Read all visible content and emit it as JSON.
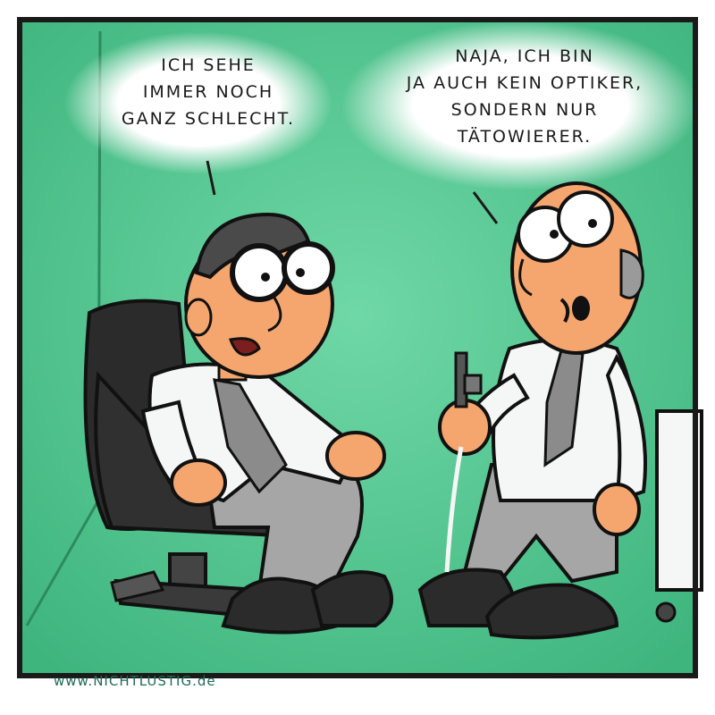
{
  "comic": {
    "colors": {
      "background": "#4cc58f",
      "frame": "#1a1a1a",
      "skin": "#f4a66e",
      "shirt": "#f4f7f6",
      "tie": "#8b8b8b",
      "chair": "#2b2b2b",
      "trousers": "#a6a6a6"
    },
    "speech_left": {
      "lines": [
        "ICH SEHE",
        "IMMER NOCH",
        "GANZ SCHLECHT."
      ]
    },
    "speech_right": {
      "lines": [
        "NAJA, ICH BIN",
        "JA AUCH KEIN OPTIKER,",
        "SONDERN NUR",
        "TÄTOWIERER."
      ]
    },
    "credit": "www.NICHTLUSTIG.de"
  }
}
